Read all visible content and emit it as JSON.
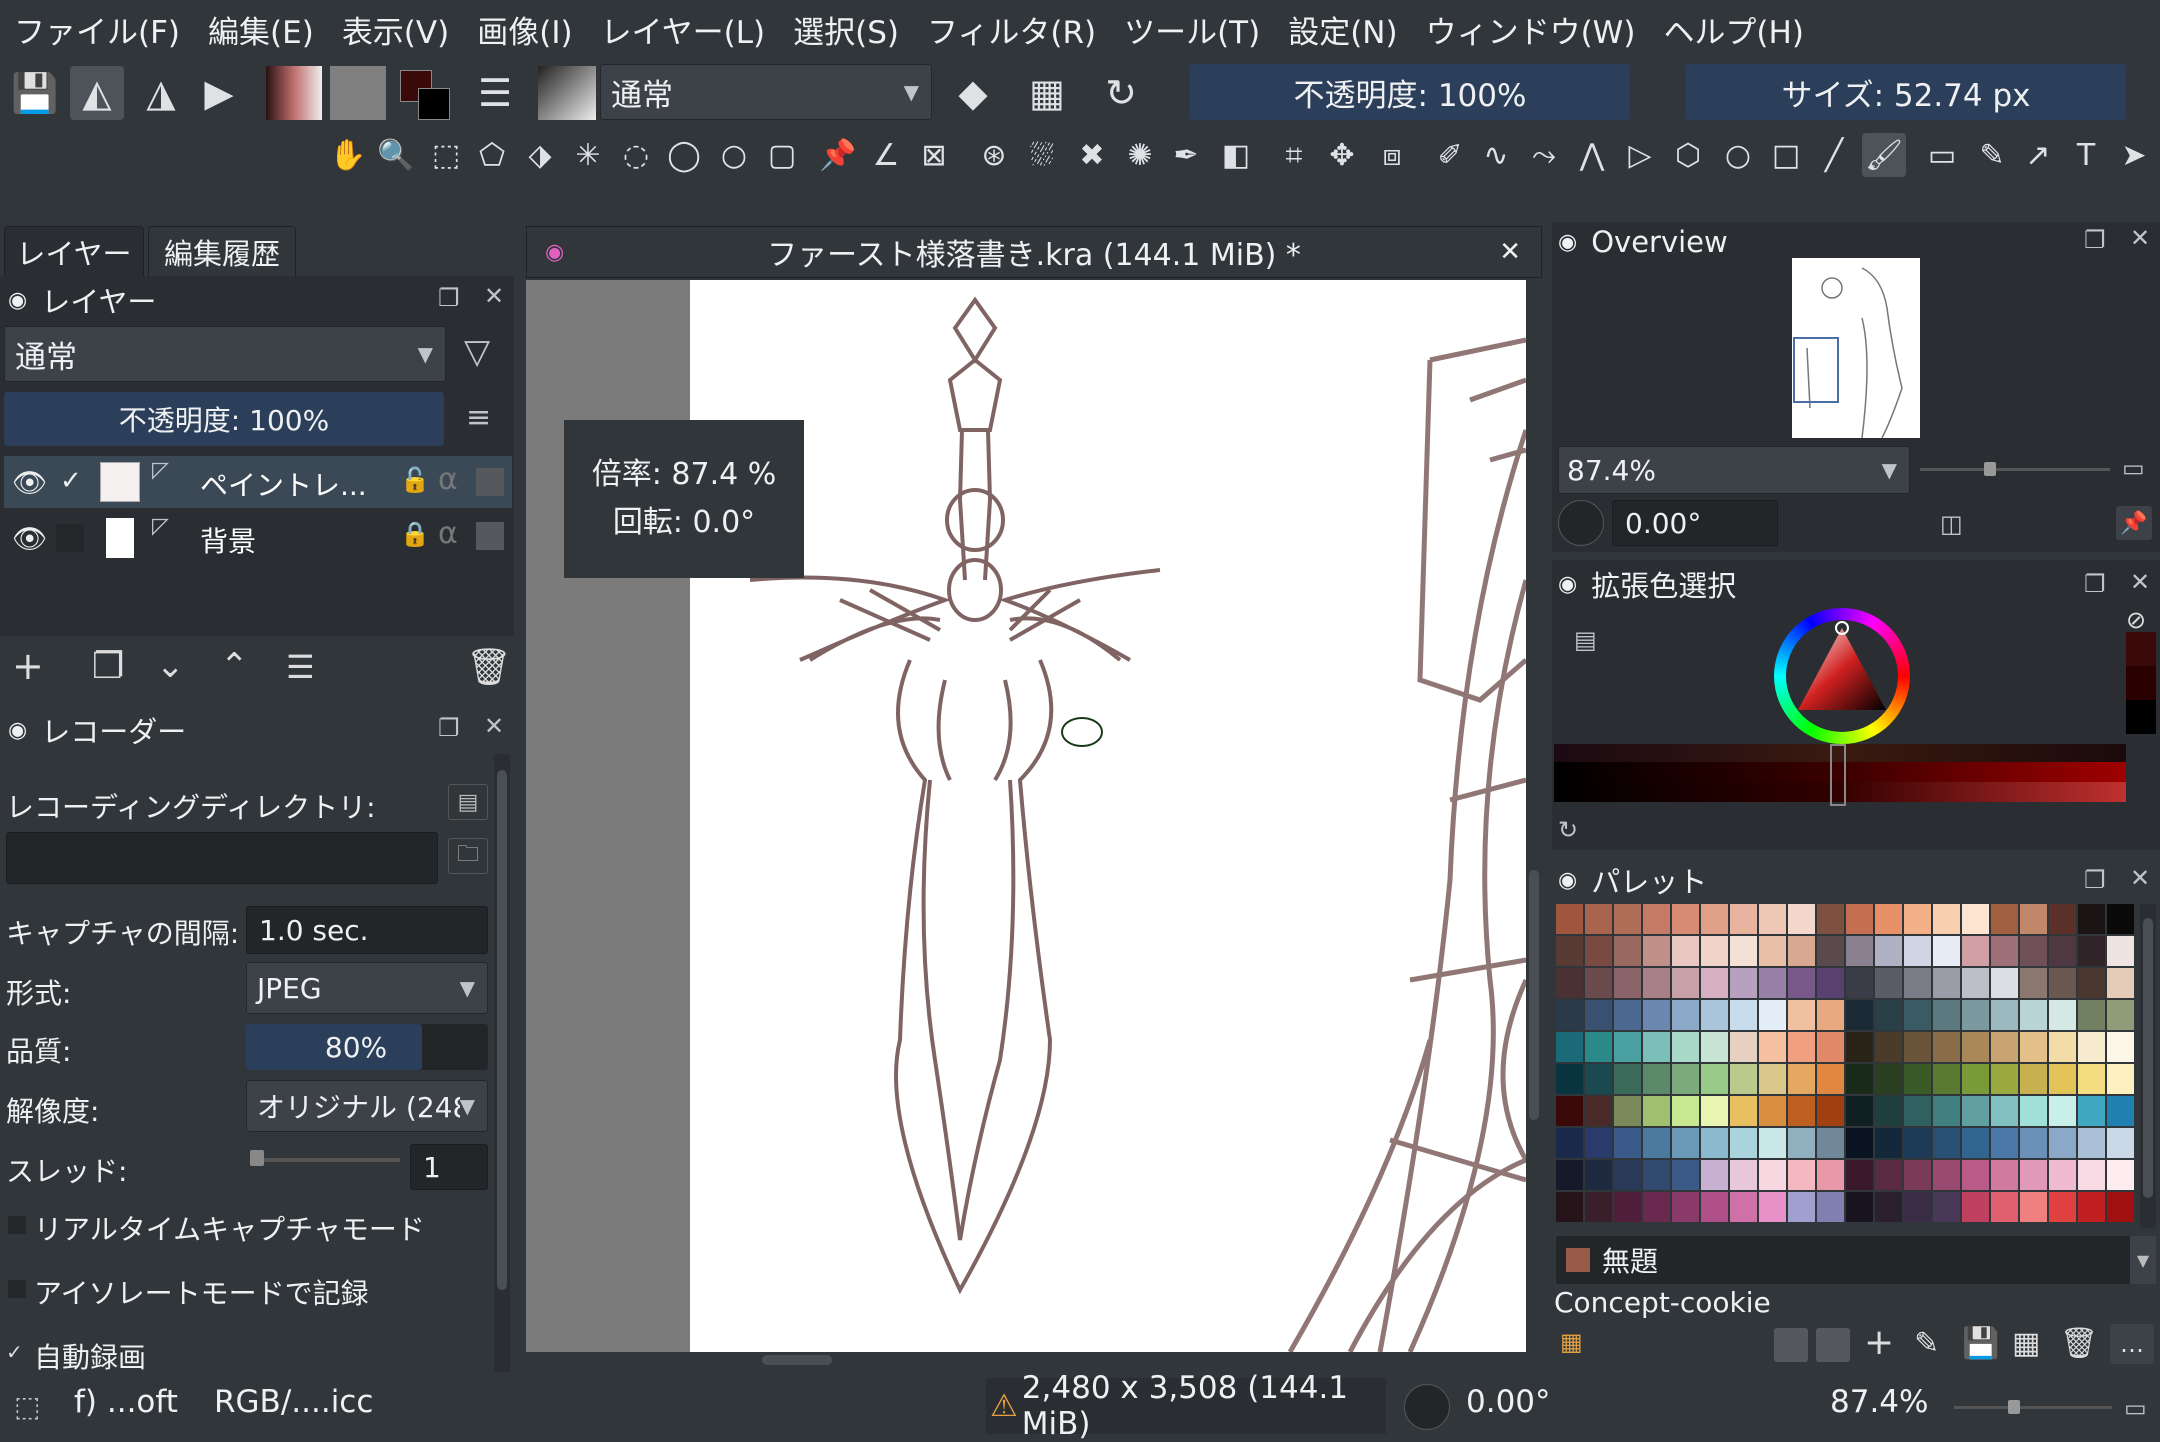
{
  "menu": [
    "ファイル(F)",
    "編集(E)",
    "表示(V)",
    "画像(I)",
    "レイヤー(L)",
    "選択(S)",
    "フィルタ(R)",
    "ツール(T)",
    "設定(N)",
    "ウィンドウ(W)",
    "ヘルプ(H)"
  ],
  "toolbar": {
    "blend_mode": "通常",
    "opacity": "不透明度: 100%",
    "size": "サイズ: 52.74 px"
  },
  "left_tabs": [
    "レイヤー",
    "編集履歴"
  ],
  "layers_panel": {
    "title": "レイヤー",
    "blend_mode": "通常",
    "opacity": "不透明度: 100%",
    "layers": [
      {
        "name": "ペイントレ...",
        "visible": true,
        "checked": true
      },
      {
        "name": "背景",
        "visible": true,
        "checked": false,
        "locked": true
      }
    ]
  },
  "recorder": {
    "title": "レコーダー",
    "dir_label": "レコーディングディレクトリ:",
    "dir_value": "",
    "interval_label": "キャプチャの間隔:",
    "interval_value": "1.0 sec.",
    "format_label": "形式:",
    "format_value": "JPEG",
    "quality_label": "品質:",
    "quality_value": "80%",
    "quality_fraction": 0.8,
    "resolution_label": "解像度:",
    "resolution_value": "オリジナル (248",
    "threads_label": "スレッド:",
    "threads_value": "1",
    "realtime_label": "リアルタイムキャプチャモード",
    "isolate_label": "アイソレートモードで記録",
    "auto_label": "自動録画",
    "auto_checked": true
  },
  "document": {
    "title": "ファースト様落書き.kra (144.1 MiB) *",
    "zoom_tip": "倍率: 87.4 %",
    "rotate_tip": "回転: 0.0°"
  },
  "overview": {
    "title": "Overview",
    "zoom": "87.4%",
    "rotation": "0.00°"
  },
  "color_selector": {
    "title": "拡張色選択",
    "accent": "#7a1010"
  },
  "palette": {
    "title": "パレット",
    "current_name": "無題",
    "palette_name": "Concept-cookie",
    "current_color": "#9a5a48",
    "colors": [
      [
        "#a0553e",
        "#a8644c",
        "#b06e56",
        "#c47a64",
        "#d88a72",
        "#e0a088",
        "#e8b4a0",
        "#f0c8b8",
        "#f4d8cc",
        "#7e5040",
        "#c47050",
        "#e89068",
        "#f4b088",
        "#f8d0b0",
        "#fce4d0",
        "#a06040",
        "#c08868",
        "#5a3028",
        "#1a1414",
        "#0a0a0a"
      ],
      [
        "#5a3a34",
        "#7a4a40",
        "#9a6a60",
        "#c09088",
        "#e8c8c0",
        "#f0d4c8",
        "#f4e0d4",
        "#e8c0a8",
        "#d8a890",
        "#5a4a4c",
        "#8a8090",
        "#b0b0c4",
        "#d0d4e4",
        "#e8ecf4",
        "#d0a0a4",
        "#a07078",
        "#705058",
        "#503840",
        "#302428",
        "#f0e4e0"
      ],
      [
        "#4a3234",
        "#6a4a4c",
        "#8a6468",
        "#a88088",
        "#c8a0a8",
        "#d4b0c0",
        "#b8a0c0",
        "#9880a8",
        "#785888",
        "#584070",
        "#3a3c48",
        "#5a5c68",
        "#7a7c88",
        "#9a9ca8",
        "#bcbec8",
        "#dcdee4",
        "#8a7870",
        "#6a5850",
        "#4a3830",
        "#e4ccb8"
      ],
      [
        "#2a3a4a",
        "#3a5070",
        "#4a6890",
        "#6a88b0",
        "#8aa8c8",
        "#aac4dc",
        "#c8dcec",
        "#e4eef8",
        "#f0c0a0",
        "#e8a880",
        "#1a2a34",
        "#2a4048",
        "#3a5a64",
        "#5a7a80",
        "#7a9aa0",
        "#9abac0",
        "#b8d4d4",
        "#d4e8e4",
        "#708060",
        "#909c78"
      ],
      [
        "#1a6a7a",
        "#2a8a8a",
        "#4aa0a0",
        "#7ac0b8",
        "#a8d8c8",
        "#c8e4d4",
        "#e8d0c0",
        "#f4c0a0",
        "#f0a080",
        "#e08868",
        "#2a2418",
        "#4a3c28",
        "#6a5438",
        "#8a6c48",
        "#aa8858",
        "#caa470",
        "#e4c088",
        "#f4dca8",
        "#f8ecd0",
        "#fcf6e8"
      ],
      [
        "#0a3440",
        "#1a4a50",
        "#3a6a5a",
        "#5a8a6a",
        "#7aaa7a",
        "#9aca8a",
        "#baca8a",
        "#dac88a",
        "#e4a860",
        "#e08840",
        "#1a2a18",
        "#2a4020",
        "#3a5a28",
        "#5a7a30",
        "#7a9a38",
        "#9aaa40",
        "#c8b050",
        "#e4c458",
        "#f4dc80",
        "#fcf0c0"
      ],
      [
        "#3a0a0a",
        "#4a2a28",
        "#7a8a5a",
        "#a0c070",
        "#c8e890",
        "#e8f4b0",
        "#e8c060",
        "#d89040",
        "#c06020",
        "#a04010",
        "#102020",
        "#204040",
        "#306060",
        "#408080",
        "#60a0a0",
        "#80c0c0",
        "#a0e0d8",
        "#c8f0e8",
        "#40a8c0",
        "#2080b0"
      ],
      [
        "#1a2a4a",
        "#2a3a6a",
        "#3a5a8a",
        "#4a7aa0",
        "#6a9ab8",
        "#8abacc",
        "#aad4dc",
        "#cae8e8",
        "#90b0c0",
        "#708898",
        "#0a1420",
        "#14283c",
        "#1e3c58",
        "#285074",
        "#326490",
        "#4a78a8",
        "#6a90b8",
        "#8aa8c8",
        "#aac0d8",
        "#cad8e8"
      ],
      [
        "#141a2a",
        "#1e2a40",
        "#283a58",
        "#324a70",
        "#3c5a88",
        "#c8b0d0",
        "#e8c8d8",
        "#f8d8e0",
        "#f4b8c0",
        "#e898a8",
        "#3a1a2a",
        "#5a2a40",
        "#7a3a58",
        "#9a4a70",
        "#ba5a88",
        "#d07aa0",
        "#e09ab8",
        "#f0bad0",
        "#f8dae4",
        "#fcecf0"
      ],
      [
        "#24141a",
        "#3a1e2a",
        "#501e3a",
        "#6a2a50",
        "#8a3a6a",
        "#b05088",
        "#d070a8",
        "#e890c8",
        "#a0a0d0",
        "#8080b0",
        "#1a1420",
        "#2a2030",
        "#3a2c44",
        "#4a3858",
        "#c04060",
        "#e06070",
        "#f08080",
        "#e04040",
        "#c02020",
        "#a01010"
      ]
    ]
  },
  "status": {
    "left": "f) ...oft",
    "profile": "RGB/....icc",
    "size": "2,480 x 3,508 (144.1 MiB)",
    "rotation": "0.00°",
    "zoom": "87.4%"
  }
}
